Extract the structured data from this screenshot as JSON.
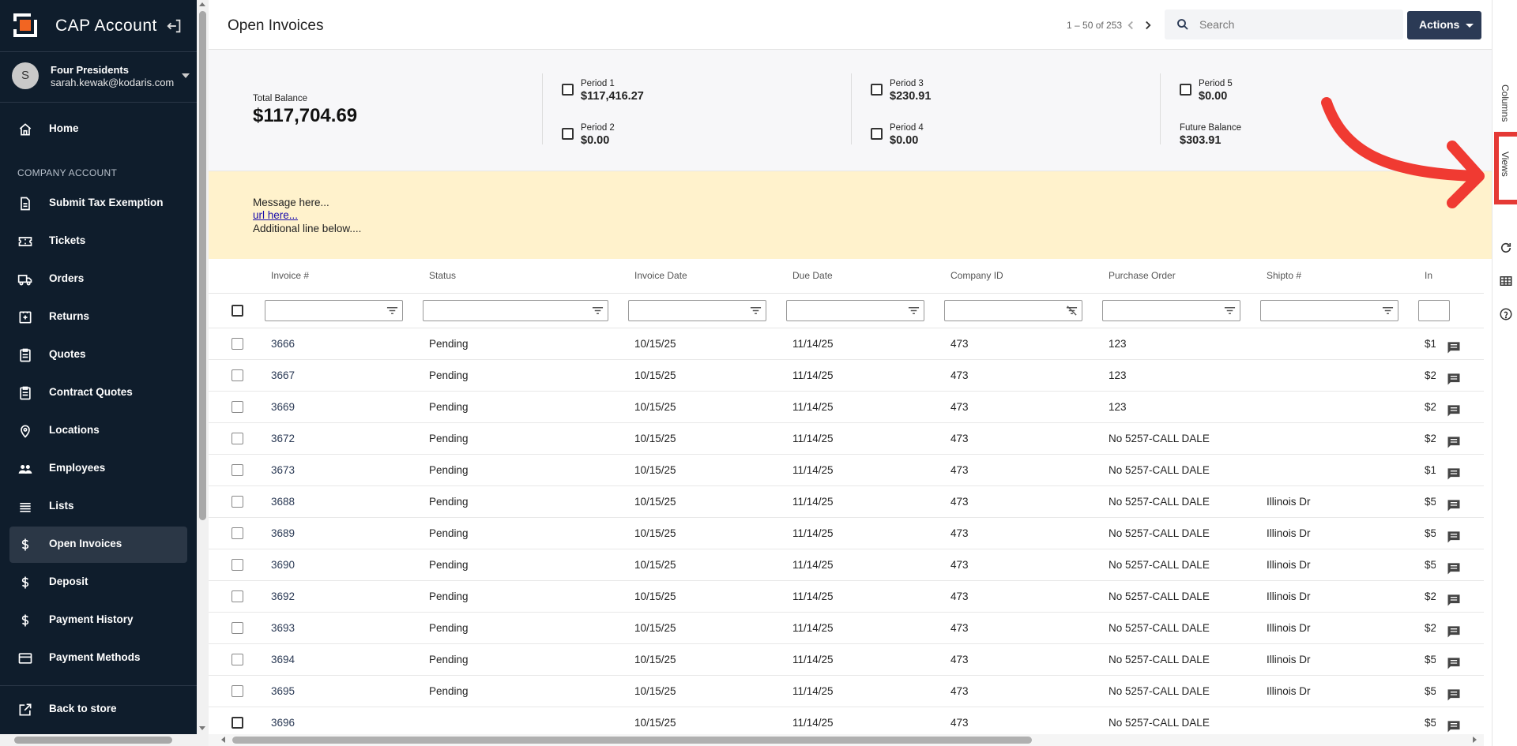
{
  "app": {
    "title": "CAP Account"
  },
  "user": {
    "initial": "S",
    "name": "Four Presidents",
    "email": "sarah.kewak@kodaris.com"
  },
  "sidebar": {
    "section_label": "COMPANY ACCOUNT",
    "items": [
      {
        "label": "Home",
        "icon": "home-icon"
      },
      {
        "label": "Submit Tax Exemption",
        "icon": "document-icon"
      },
      {
        "label": "Tickets",
        "icon": "ticket-icon"
      },
      {
        "label": "Orders",
        "icon": "truck-icon"
      },
      {
        "label": "Returns",
        "icon": "return-icon"
      },
      {
        "label": "Quotes",
        "icon": "clipboard-icon"
      },
      {
        "label": "Contract Quotes",
        "icon": "clipboard-icon"
      },
      {
        "label": "Locations",
        "icon": "location-pin-icon"
      },
      {
        "label": "Employees",
        "icon": "people-icon"
      },
      {
        "label": "Lists",
        "icon": "list-icon"
      },
      {
        "label": "Open Invoices",
        "icon": "dollar-icon",
        "active": true
      },
      {
        "label": "Deposit",
        "icon": "dollar-icon"
      },
      {
        "label": "Payment History",
        "icon": "dollar-icon"
      },
      {
        "label": "Payment Methods",
        "icon": "credit-card-icon"
      }
    ],
    "back_label": "Back to store"
  },
  "header": {
    "page_title": "Open Invoices",
    "pager": "1 – 50 of 253",
    "search_placeholder": "Search",
    "actions_label": "Actions"
  },
  "summary": {
    "total_label": "Total Balance",
    "total_value": "$117,704.69",
    "periods": [
      {
        "label": "Period 1",
        "value": "$117,416.27"
      },
      {
        "label": "Period 2",
        "value": "$0.00"
      },
      {
        "label": "Period 3",
        "value": "$230.91"
      },
      {
        "label": "Period 4",
        "value": "$0.00"
      },
      {
        "label": "Period 5",
        "value": "$0.00"
      }
    ],
    "future_label": "Future Balance",
    "future_value": "$303.91"
  },
  "message": {
    "line1": "Message here...",
    "link": "url here...",
    "line2": "Additional line below...."
  },
  "table": {
    "columns": [
      "Invoice #",
      "Status",
      "Invoice Date",
      "Due Date",
      "Company ID",
      "Purchase Order",
      "Shipto #",
      "In"
    ],
    "rows": [
      {
        "invoice": "3666",
        "status": "Pending",
        "invoice_date": "10/15/25",
        "due_date": "11/14/25",
        "company_id": "473",
        "po": "123",
        "shipto": "",
        "amount": "$1"
      },
      {
        "invoice": "3667",
        "status": "Pending",
        "invoice_date": "10/15/25",
        "due_date": "11/14/25",
        "company_id": "473",
        "po": "123",
        "shipto": "",
        "amount": "$2"
      },
      {
        "invoice": "3669",
        "status": "Pending",
        "invoice_date": "10/15/25",
        "due_date": "11/14/25",
        "company_id": "473",
        "po": "123",
        "shipto": "",
        "amount": "$2"
      },
      {
        "invoice": "3672",
        "status": "Pending",
        "invoice_date": "10/15/25",
        "due_date": "11/14/25",
        "company_id": "473",
        "po": "No 5257-CALL DALE",
        "shipto": "",
        "amount": "$2"
      },
      {
        "invoice": "3673",
        "status": "Pending",
        "invoice_date": "10/15/25",
        "due_date": "11/14/25",
        "company_id": "473",
        "po": "No 5257-CALL DALE",
        "shipto": "",
        "amount": "$1"
      },
      {
        "invoice": "3688",
        "status": "Pending",
        "invoice_date": "10/15/25",
        "due_date": "11/14/25",
        "company_id": "473",
        "po": "No 5257-CALL DALE",
        "shipto": "Illinois Dr",
        "amount": "$5"
      },
      {
        "invoice": "3689",
        "status": "Pending",
        "invoice_date": "10/15/25",
        "due_date": "11/14/25",
        "company_id": "473",
        "po": "No 5257-CALL DALE",
        "shipto": "Illinois Dr",
        "amount": "$5"
      },
      {
        "invoice": "3690",
        "status": "Pending",
        "invoice_date": "10/15/25",
        "due_date": "11/14/25",
        "company_id": "473",
        "po": "No 5257-CALL DALE",
        "shipto": "Illinois Dr",
        "amount": "$5"
      },
      {
        "invoice": "3692",
        "status": "Pending",
        "invoice_date": "10/15/25",
        "due_date": "11/14/25",
        "company_id": "473",
        "po": "No 5257-CALL DALE",
        "shipto": "Illinois Dr",
        "amount": "$2"
      },
      {
        "invoice": "3693",
        "status": "Pending",
        "invoice_date": "10/15/25",
        "due_date": "11/14/25",
        "company_id": "473",
        "po": "No 5257-CALL DALE",
        "shipto": "Illinois Dr",
        "amount": "$2"
      },
      {
        "invoice": "3694",
        "status": "Pending",
        "invoice_date": "10/15/25",
        "due_date": "11/14/25",
        "company_id": "473",
        "po": "No 5257-CALL DALE",
        "shipto": "Illinois Dr",
        "amount": "$5"
      },
      {
        "invoice": "3695",
        "status": "Pending",
        "invoice_date": "10/15/25",
        "due_date": "11/14/25",
        "company_id": "473",
        "po": "No 5257-CALL DALE",
        "shipto": "Illinois Dr",
        "amount": "$5"
      },
      {
        "invoice": "3696",
        "status": "",
        "invoice_date": "10/15/25",
        "due_date": "11/14/25",
        "company_id": "473",
        "po": "No 5257-CALL DALE",
        "shipto": "",
        "amount": "$5"
      }
    ]
  },
  "right_panel": {
    "tabs": [
      "Columns",
      "Views"
    ]
  },
  "colors": {
    "sidebar_bg": "#0f1d2c",
    "accent": "#2b3a55",
    "message_bg": "#fff2cc",
    "highlight": "#e53935",
    "logo_orange": "#f26522"
  }
}
